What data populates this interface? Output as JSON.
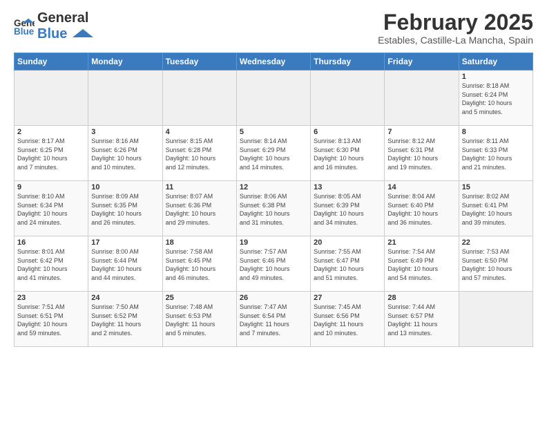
{
  "header": {
    "logo_line1": "General",
    "logo_line2": "Blue",
    "month_year": "February 2025",
    "location": "Estables, Castille-La Mancha, Spain"
  },
  "days_of_week": [
    "Sunday",
    "Monday",
    "Tuesday",
    "Wednesday",
    "Thursday",
    "Friday",
    "Saturday"
  ],
  "weeks": [
    {
      "days": [
        {
          "num": "",
          "info": ""
        },
        {
          "num": "",
          "info": ""
        },
        {
          "num": "",
          "info": ""
        },
        {
          "num": "",
          "info": ""
        },
        {
          "num": "",
          "info": ""
        },
        {
          "num": "",
          "info": ""
        },
        {
          "num": "1",
          "info": "Sunrise: 8:18 AM\nSunset: 6:24 PM\nDaylight: 10 hours\nand 5 minutes."
        }
      ]
    },
    {
      "days": [
        {
          "num": "2",
          "info": "Sunrise: 8:17 AM\nSunset: 6:25 PM\nDaylight: 10 hours\nand 7 minutes."
        },
        {
          "num": "3",
          "info": "Sunrise: 8:16 AM\nSunset: 6:26 PM\nDaylight: 10 hours\nand 10 minutes."
        },
        {
          "num": "4",
          "info": "Sunrise: 8:15 AM\nSunset: 6:28 PM\nDaylight: 10 hours\nand 12 minutes."
        },
        {
          "num": "5",
          "info": "Sunrise: 8:14 AM\nSunset: 6:29 PM\nDaylight: 10 hours\nand 14 minutes."
        },
        {
          "num": "6",
          "info": "Sunrise: 8:13 AM\nSunset: 6:30 PM\nDaylight: 10 hours\nand 16 minutes."
        },
        {
          "num": "7",
          "info": "Sunrise: 8:12 AM\nSunset: 6:31 PM\nDaylight: 10 hours\nand 19 minutes."
        },
        {
          "num": "8",
          "info": "Sunrise: 8:11 AM\nSunset: 6:33 PM\nDaylight: 10 hours\nand 21 minutes."
        }
      ]
    },
    {
      "days": [
        {
          "num": "9",
          "info": "Sunrise: 8:10 AM\nSunset: 6:34 PM\nDaylight: 10 hours\nand 24 minutes."
        },
        {
          "num": "10",
          "info": "Sunrise: 8:09 AM\nSunset: 6:35 PM\nDaylight: 10 hours\nand 26 minutes."
        },
        {
          "num": "11",
          "info": "Sunrise: 8:07 AM\nSunset: 6:36 PM\nDaylight: 10 hours\nand 29 minutes."
        },
        {
          "num": "12",
          "info": "Sunrise: 8:06 AM\nSunset: 6:38 PM\nDaylight: 10 hours\nand 31 minutes."
        },
        {
          "num": "13",
          "info": "Sunrise: 8:05 AM\nSunset: 6:39 PM\nDaylight: 10 hours\nand 34 minutes."
        },
        {
          "num": "14",
          "info": "Sunrise: 8:04 AM\nSunset: 6:40 PM\nDaylight: 10 hours\nand 36 minutes."
        },
        {
          "num": "15",
          "info": "Sunrise: 8:02 AM\nSunset: 6:41 PM\nDaylight: 10 hours\nand 39 minutes."
        }
      ]
    },
    {
      "days": [
        {
          "num": "16",
          "info": "Sunrise: 8:01 AM\nSunset: 6:42 PM\nDaylight: 10 hours\nand 41 minutes."
        },
        {
          "num": "17",
          "info": "Sunrise: 8:00 AM\nSunset: 6:44 PM\nDaylight: 10 hours\nand 44 minutes."
        },
        {
          "num": "18",
          "info": "Sunrise: 7:58 AM\nSunset: 6:45 PM\nDaylight: 10 hours\nand 46 minutes."
        },
        {
          "num": "19",
          "info": "Sunrise: 7:57 AM\nSunset: 6:46 PM\nDaylight: 10 hours\nand 49 minutes."
        },
        {
          "num": "20",
          "info": "Sunrise: 7:55 AM\nSunset: 6:47 PM\nDaylight: 10 hours\nand 51 minutes."
        },
        {
          "num": "21",
          "info": "Sunrise: 7:54 AM\nSunset: 6:49 PM\nDaylight: 10 hours\nand 54 minutes."
        },
        {
          "num": "22",
          "info": "Sunrise: 7:53 AM\nSunset: 6:50 PM\nDaylight: 10 hours\nand 57 minutes."
        }
      ]
    },
    {
      "days": [
        {
          "num": "23",
          "info": "Sunrise: 7:51 AM\nSunset: 6:51 PM\nDaylight: 10 hours\nand 59 minutes."
        },
        {
          "num": "24",
          "info": "Sunrise: 7:50 AM\nSunset: 6:52 PM\nDaylight: 11 hours\nand 2 minutes."
        },
        {
          "num": "25",
          "info": "Sunrise: 7:48 AM\nSunset: 6:53 PM\nDaylight: 11 hours\nand 5 minutes."
        },
        {
          "num": "26",
          "info": "Sunrise: 7:47 AM\nSunset: 6:54 PM\nDaylight: 11 hours\nand 7 minutes."
        },
        {
          "num": "27",
          "info": "Sunrise: 7:45 AM\nSunset: 6:56 PM\nDaylight: 11 hours\nand 10 minutes."
        },
        {
          "num": "28",
          "info": "Sunrise: 7:44 AM\nSunset: 6:57 PM\nDaylight: 11 hours\nand 13 minutes."
        },
        {
          "num": "",
          "info": ""
        }
      ]
    }
  ]
}
